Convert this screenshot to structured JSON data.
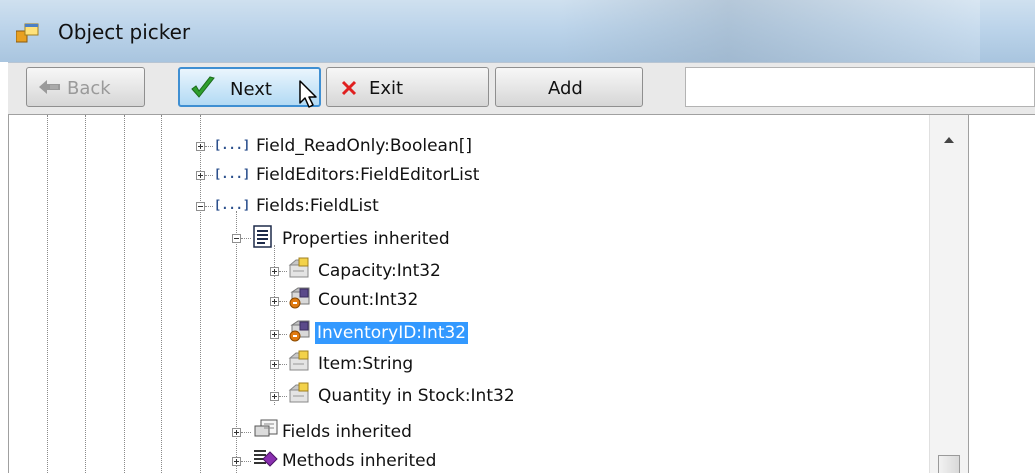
{
  "window": {
    "title": "Object picker"
  },
  "toolbar": {
    "back_label": "Back",
    "next_label": "Next",
    "exit_label": "Exit",
    "add_label": "Add",
    "address_value": ""
  },
  "tree": {
    "nodes": [
      {
        "label": "Field_ReadOnly:Boolean[]",
        "icon": "array-icon",
        "expander": "plus"
      },
      {
        "label": "FieldEditors:FieldEditorList",
        "icon": "array-icon",
        "expander": "plus"
      },
      {
        "label": "Fields:FieldList",
        "icon": "array-icon",
        "expander": "minus"
      },
      {
        "label": "Properties inherited",
        "icon": "properties-group-icon",
        "expander": "minus"
      },
      {
        "label": "Capacity:Int32",
        "icon": "property-icon",
        "expander": "plus"
      },
      {
        "label": "Count:Int32",
        "icon": "readonly-property-icon",
        "expander": "plus"
      },
      {
        "label": "InventoryID:Int32",
        "icon": "readonly-property-icon",
        "expander": "plus",
        "selected": true
      },
      {
        "label": "Item:String",
        "icon": "property-icon",
        "expander": "plus"
      },
      {
        "label": "Quantity in Stock:Int32",
        "icon": "property-icon",
        "expander": "plus"
      },
      {
        "label": "Fields inherited",
        "icon": "fields-group-icon",
        "expander": "plus"
      },
      {
        "label": "Methods inherited",
        "icon": "methods-group-icon",
        "expander": "plus"
      }
    ]
  },
  "colors": {
    "selection": "#3399ff",
    "titlebar": "#bcd4ea",
    "accent_check": "#2e9e2e",
    "exit_x": "#e02020"
  }
}
